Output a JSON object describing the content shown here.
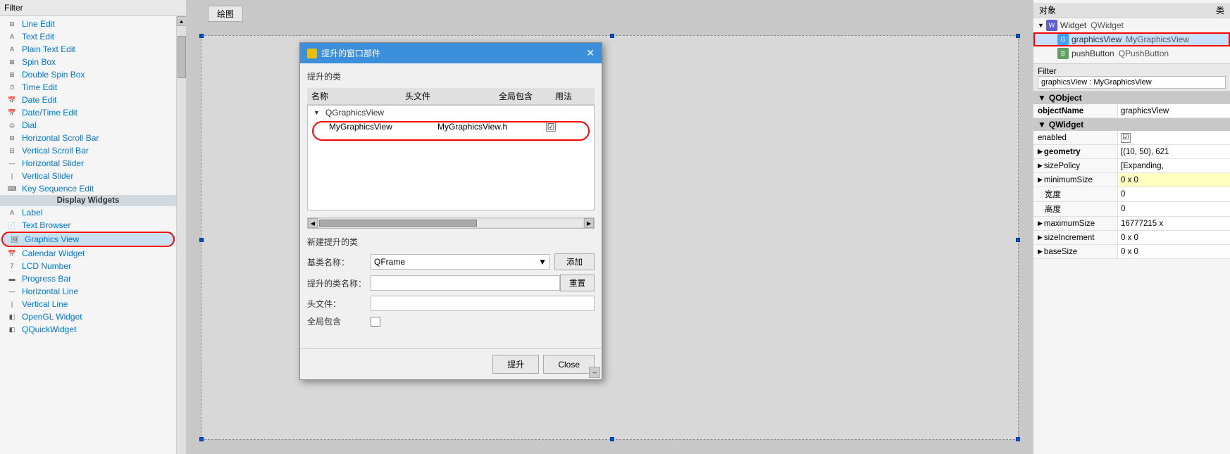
{
  "leftPanel": {
    "filterLabel": "Filter",
    "items": [
      {
        "label": "Line Edit",
        "icon": "⊟",
        "type": "widget"
      },
      {
        "label": "Text Edit",
        "icon": "A",
        "type": "widget"
      },
      {
        "label": "Plain Text Edit",
        "icon": "A",
        "type": "widget"
      },
      {
        "label": "Spin Box",
        "icon": "⊞",
        "type": "widget"
      },
      {
        "label": "Double Spin Box",
        "icon": "⊞",
        "type": "widget"
      },
      {
        "label": "Time Edit",
        "icon": "⏱",
        "type": "widget"
      },
      {
        "label": "Date Edit",
        "icon": "📅",
        "type": "widget"
      },
      {
        "label": "Date/Time Edit",
        "icon": "📅",
        "type": "widget"
      },
      {
        "label": "Dial",
        "icon": "◎",
        "type": "widget"
      },
      {
        "label": "Horizontal Scroll Bar",
        "icon": "⊟",
        "type": "widget"
      },
      {
        "label": "Vertical Scroll Bar",
        "icon": "⊟",
        "type": "widget"
      },
      {
        "label": "Horizontal Slider",
        "icon": "—",
        "type": "widget"
      },
      {
        "label": "Vertical Slider",
        "icon": "|",
        "type": "widget"
      },
      {
        "label": "Key Sequence Edit",
        "icon": "⌨",
        "type": "widget"
      },
      {
        "label": "Display Widgets",
        "type": "category"
      },
      {
        "label": "Label",
        "icon": "A",
        "type": "widget"
      },
      {
        "label": "Text Browser",
        "icon": "📄",
        "type": "widget"
      },
      {
        "label": "Graphics View",
        "icon": "🖼",
        "type": "widget",
        "highlighted": true
      },
      {
        "label": "Calendar Widget",
        "icon": "📅",
        "type": "widget"
      },
      {
        "label": "LCD Number",
        "icon": "7",
        "type": "widget"
      },
      {
        "label": "Progress Bar",
        "icon": "▬",
        "type": "widget"
      },
      {
        "label": "Horizontal Line",
        "icon": "—",
        "type": "widget"
      },
      {
        "label": "Vertical Line",
        "icon": "|",
        "type": "widget"
      },
      {
        "label": "OpenGL Widget",
        "icon": "◧",
        "type": "widget"
      },
      {
        "label": "QQuickWidget",
        "icon": "◧",
        "type": "widget"
      }
    ]
  },
  "canvas": {
    "buttonLabel": "绘图"
  },
  "dialog": {
    "title": "提升的窗口部件",
    "closeBtn": "✕",
    "sectionTitle": "提升的类",
    "tableHeaders": {
      "name": "名称",
      "headerFile": "头文件",
      "globalInclude": "全局包含",
      "usage": "用法"
    },
    "promotedItems": [
      {
        "parent": "QGraphicsView",
        "children": [
          {
            "name": "MyGraphicsView",
            "header": "MyGraphicsView.h",
            "checked": true
          }
        ]
      }
    ],
    "newSectionTitle": "新建提升的类",
    "baseClassLabel": "基类名称：",
    "baseClassValue": "QFrame",
    "promotedNameLabel": "提升的类名称：",
    "promotedNameValue": "",
    "headerFileLabel": "头文件：",
    "headerFileValue": "",
    "globalIncludeLabel": "全局包含",
    "addBtn": "添加",
    "resetBtn": "重置",
    "promoteBtn": "提升",
    "closeButton": "Close"
  },
  "rightPanel": {
    "titleObject": "对象",
    "titleClass": "类",
    "objectTree": [
      {
        "level": 0,
        "name": "Widget",
        "class": "QWidget",
        "icon": "W",
        "hasChevron": true
      },
      {
        "level": 1,
        "name": "graphicsView",
        "class": "MyGraphicsView",
        "icon": "G",
        "highlighted": true
      },
      {
        "level": 1,
        "name": "pushButton",
        "class": "QPushButton",
        "icon": "B"
      }
    ],
    "filterLabel": "Filter",
    "filterValue": "graphicsView : MyGraphicsView",
    "properties": {
      "sections": [
        {
          "name": "QObject",
          "rows": [
            {
              "name": "objectName",
              "value": "graphicsView",
              "bold": true
            }
          ]
        },
        {
          "name": "QWidget",
          "rows": [
            {
              "name": "enabled",
              "value": "☑",
              "type": "checkbox"
            },
            {
              "name": "geometry",
              "value": "[(10, 50), 621",
              "expandable": true,
              "bold": true
            },
            {
              "name": "sizePolicy",
              "value": "[Expanding,",
              "expandable": true
            },
            {
              "name": "minimumSize",
              "value": "0 x 0",
              "expandable": true,
              "yellowBg": true
            },
            {
              "name": "宽度",
              "value": "0",
              "indented": true
            },
            {
              "name": "高度",
              "value": "0",
              "indented": true
            },
            {
              "name": "maximumSize",
              "value": "16777215 x",
              "expandable": true
            },
            {
              "name": "sizeIncrement",
              "value": "0 x 0",
              "expandable": true
            },
            {
              "name": "baseSize",
              "value": "0 x 0",
              "expandable": true
            }
          ]
        }
      ]
    }
  }
}
